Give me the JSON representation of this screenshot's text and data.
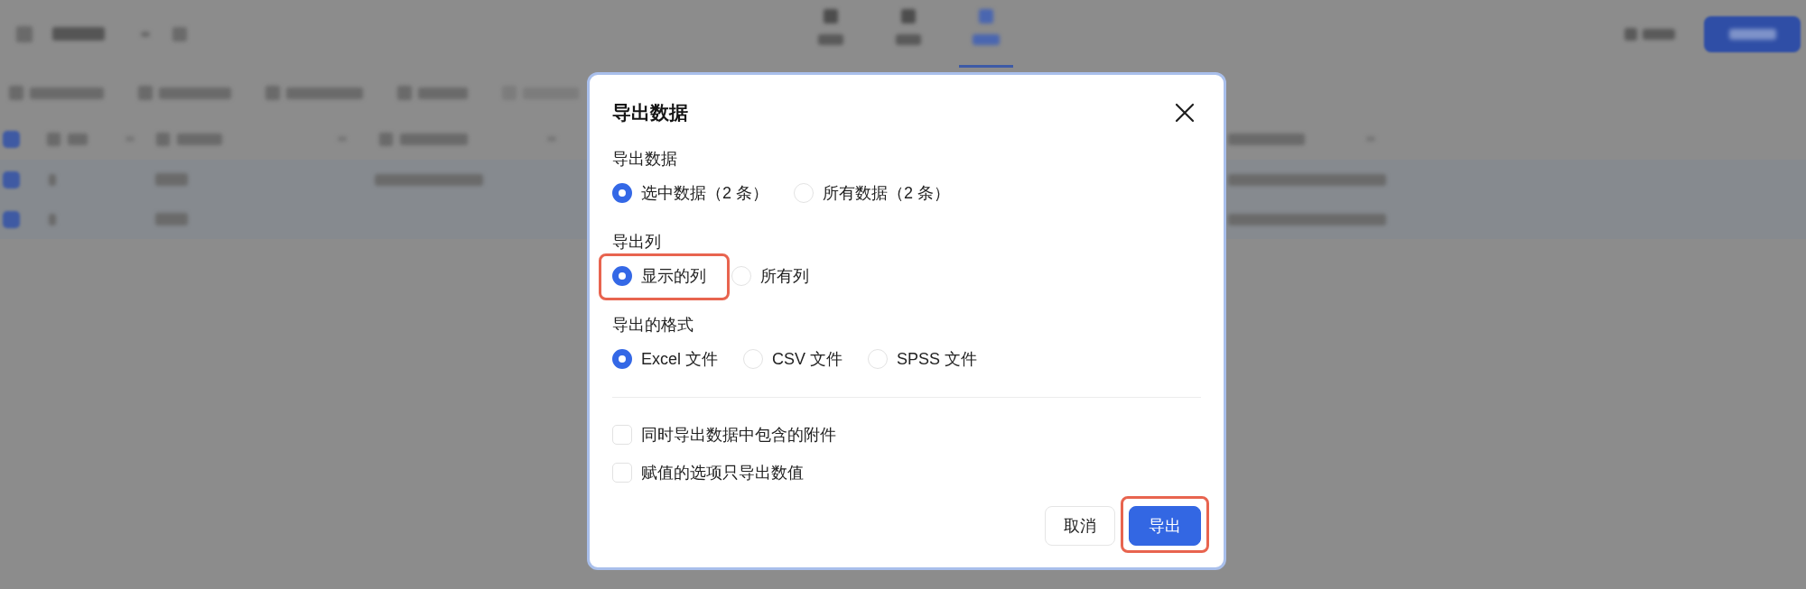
{
  "backdrop": {
    "tabs": [
      {
        "selected": false
      },
      {
        "selected": false
      },
      {
        "selected": true
      }
    ],
    "table": {
      "header_checked": true,
      "rows": [
        {
          "checked": true
        },
        {
          "checked": true
        }
      ]
    }
  },
  "dialog": {
    "title": "导出数据",
    "sections": [
      {
        "label": "导出数据",
        "options": [
          {
            "label": "选中数据（2 条）",
            "selected": true,
            "highlighted": false
          },
          {
            "label": "所有数据（2 条）",
            "selected": false,
            "highlighted": false
          }
        ]
      },
      {
        "label": "导出列",
        "options": [
          {
            "label": "显示的列",
            "selected": true,
            "highlighted": true
          },
          {
            "label": "所有列",
            "selected": false,
            "highlighted": false
          }
        ]
      },
      {
        "label": "导出的格式",
        "options": [
          {
            "label": "Excel 文件",
            "selected": true,
            "highlighted": false
          },
          {
            "label": "CSV 文件",
            "selected": false,
            "highlighted": false
          },
          {
            "label": "SPSS 文件",
            "selected": false,
            "highlighted": false
          }
        ]
      }
    ],
    "checkboxes": [
      {
        "label": "同时导出数据中包含的附件",
        "checked": false
      },
      {
        "label": "赋值的选项只导出数值",
        "checked": false
      }
    ],
    "buttons": [
      {
        "label": "取消",
        "kind": "secondary",
        "highlighted": false
      },
      {
        "label": "导出",
        "kind": "primary",
        "highlighted": true
      }
    ]
  }
}
